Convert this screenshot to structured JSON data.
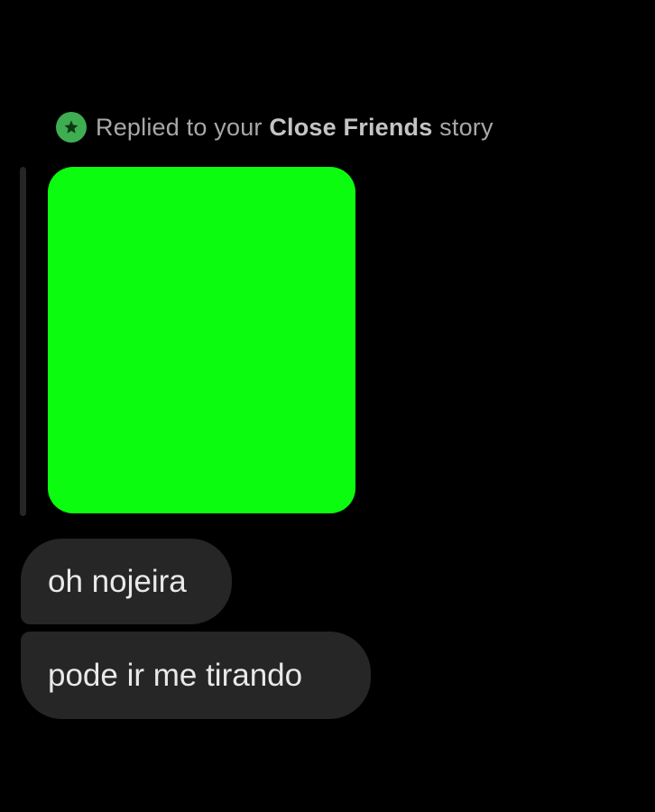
{
  "reply_header": {
    "icon": "close-friends-star-icon",
    "prefix": "Replied to your ",
    "highlight": "Close Friends",
    "suffix": " story"
  },
  "story_preview": {
    "fill_color": "#0cfc0f"
  },
  "messages": [
    {
      "text": "oh nojeira"
    },
    {
      "text": "pode ir me tirando"
    }
  ],
  "colors": {
    "background": "#000000",
    "bubble": "#262626",
    "close_friends_green": "#3fae52"
  }
}
